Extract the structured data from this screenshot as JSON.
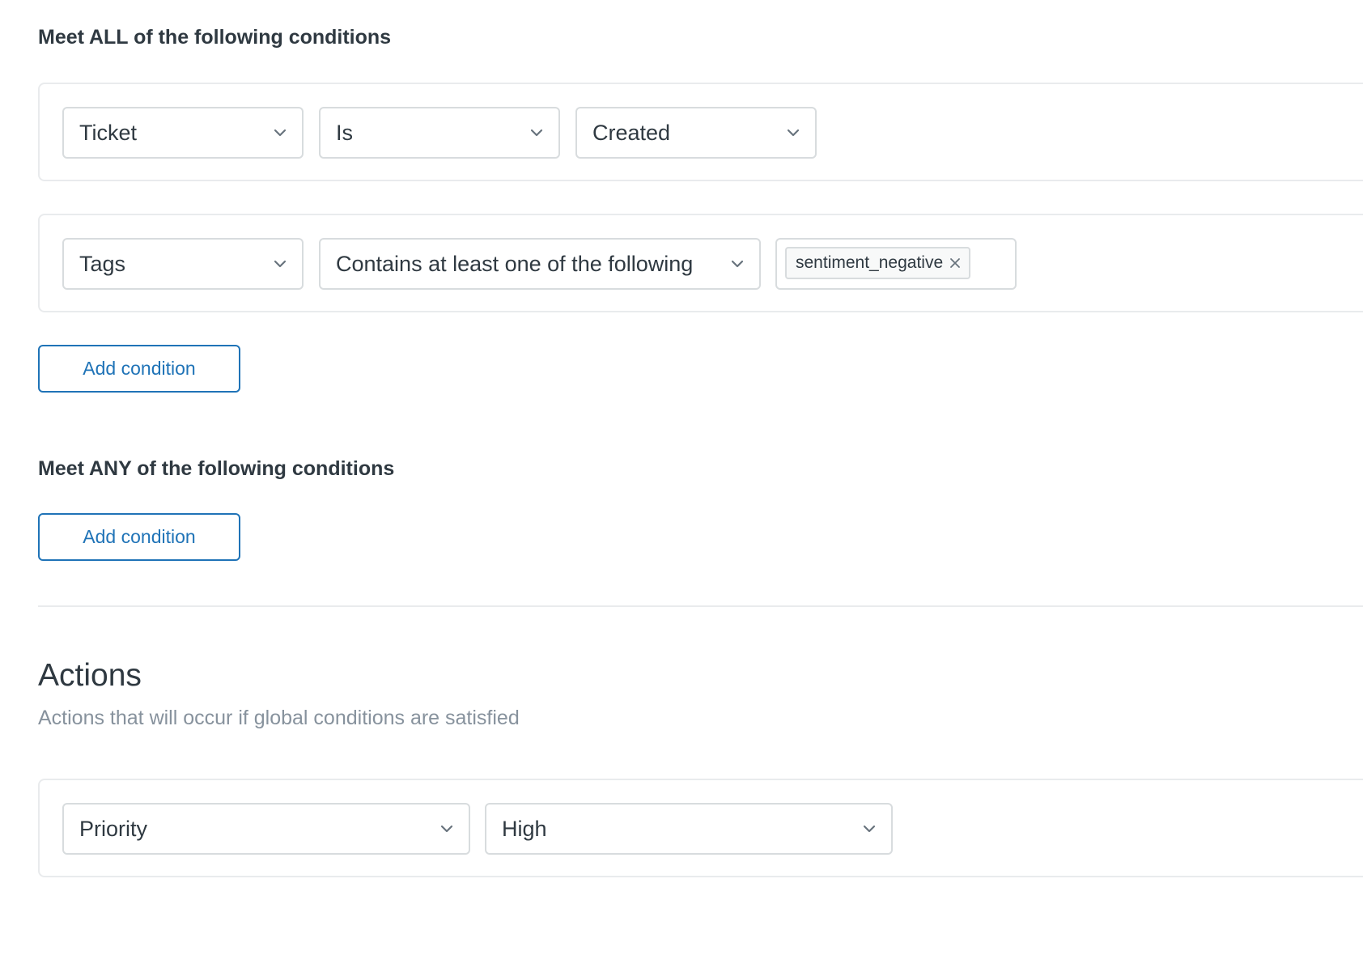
{
  "all_conditions": {
    "heading": "Meet ALL of the following conditions",
    "rows": [
      {
        "field": "Ticket",
        "operator": "Is",
        "value": "Created"
      },
      {
        "field": "Tags",
        "operator": "Contains at least one of the following",
        "tags": [
          "sentiment_negative"
        ]
      }
    ],
    "add_label": "Add condition"
  },
  "any_conditions": {
    "heading": "Meet ANY of the following conditions",
    "add_label": "Add condition"
  },
  "actions": {
    "title": "Actions",
    "description": "Actions that will occur if global conditions are satisfied",
    "rows": [
      {
        "field": "Priority",
        "value": "High"
      }
    ]
  },
  "colors": {
    "primary_blue": "#1f73b7",
    "text": "#2f3941",
    "muted_text": "#87929d",
    "border": "#d8dcde",
    "card_border": "#e9ebed"
  },
  "icons": {
    "select_arrow": "chevron-down-icon",
    "tag_remove": "close-icon"
  }
}
